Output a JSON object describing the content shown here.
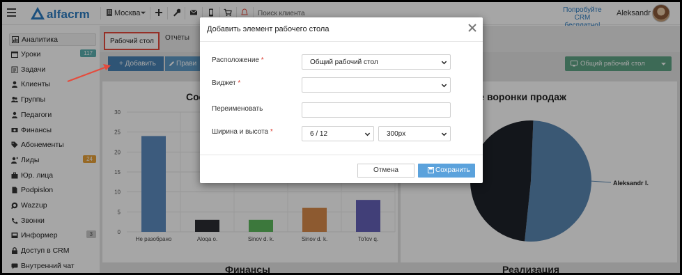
{
  "topbar": {
    "logo_text": "alfacrm",
    "branch": "Москва",
    "search_placeholder": "Поиск клиента",
    "promo_line1": "Попробуйте",
    "promo_line2": "CRM бесплатно!",
    "user_name": "Aleksandr"
  },
  "sidebar": {
    "items": [
      {
        "label": "Аналитика",
        "icon": "analytics-icon",
        "badge": ""
      },
      {
        "label": "Уроки",
        "icon": "calendar-icon",
        "badge": "117"
      },
      {
        "label": "Задачи",
        "icon": "tasks-icon",
        "badge": ""
      },
      {
        "label": "Клиенты",
        "icon": "user-icon",
        "badge": ""
      },
      {
        "label": "Группы",
        "icon": "group-icon",
        "badge": ""
      },
      {
        "label": "Педагоги",
        "icon": "teacher-icon",
        "badge": ""
      },
      {
        "label": "Финансы",
        "icon": "money-icon",
        "badge": ""
      },
      {
        "label": "Абонементы",
        "icon": "tag-icon",
        "badge": ""
      },
      {
        "label": "Лиды",
        "icon": "lead-icon",
        "badge": "24"
      },
      {
        "label": "Юр. лица",
        "icon": "briefcase-icon",
        "badge": ""
      },
      {
        "label": "Podpislon",
        "icon": "document-icon",
        "badge": ""
      },
      {
        "label": "Wazzup",
        "icon": "whatsapp-icon",
        "badge": ""
      },
      {
        "label": "Звонки",
        "icon": "phone-icon",
        "badge": ""
      },
      {
        "label": "Информер",
        "icon": "inbox-icon",
        "badge": "3"
      },
      {
        "label": "Доступ в CRM",
        "icon": "lock-icon",
        "badge": ""
      },
      {
        "label": "Внутренний чат",
        "icon": "chat-icon",
        "badge": ""
      }
    ]
  },
  "main": {
    "tab_desktop": "Рабочий стол",
    "tab_reports": "Отчёты",
    "add_button": "+ Добавить",
    "edit_button": "Прави",
    "dashboard_button": "Общий рабочий стол",
    "panel_left_title": "Сост",
    "panel_right_title": "тояние воронки продаж",
    "panel_bottom_left_title": "Финансы",
    "panel_bottom_right_title": "Реализация",
    "pie_label": "Aleksandr I."
  },
  "colors": {
    "accent": "#2b7cc1",
    "highlight_border": "#e54b3c",
    "add_button": "#4782b4",
    "dashboard_button": "#5fa385",
    "save_button": "#5ba2dc",
    "pie_dark": "#1e222a",
    "pie_blue": "#5a87b3"
  },
  "chart_data": {
    "type": "bar",
    "categories": [
      "Не разобрано",
      "Aloqa o.",
      "Sinov d. k.",
      "Sinov d. k.",
      "To'lov q."
    ],
    "values": [
      24,
      3,
      3,
      6,
      8
    ],
    "colors": [
      "#5d8cc0",
      "#2b2d33",
      "#5cb85c",
      "#d98b4a",
      "#6561b8"
    ],
    "yticks": [
      "30",
      "25",
      "20",
      "15",
      "10",
      "5",
      "0"
    ],
    "ylim": [
      0,
      30
    ],
    "grid": true
  },
  "pie_data": {
    "type": "pie",
    "values": [
      51,
      49
    ],
    "colors": [
      "#5a87b3",
      "#1e222a"
    ]
  },
  "modal": {
    "title": "Добавить элемент рабочего стола",
    "location_label": "Расположение",
    "location_value": "Общий рабочий стол",
    "widget_label": "Виджет",
    "widget_value": "",
    "rename_label": "Переименовать",
    "rename_value": "",
    "size_label": "Ширина и высота",
    "width_value": "6 / 12",
    "height_value": "300px",
    "required_mark": "*",
    "cancel_label": "Отмена",
    "save_label": "Сохранить"
  }
}
